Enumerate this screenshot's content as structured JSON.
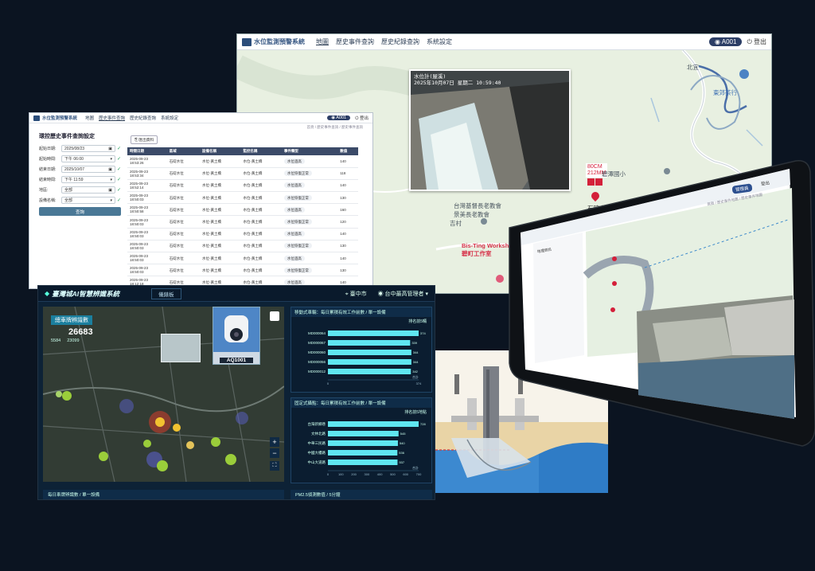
{
  "map_window": {
    "brand": "水位監測預警系統",
    "nav": [
      "地圖",
      "歷史事件查詢",
      "歷史紀錄查詢",
      "系統設定"
    ],
    "user": "A001",
    "logout": "登出",
    "camera": {
      "line1": "水位計(屋溪)",
      "line2": "2025年10月07日 星期二 10:59:40"
    },
    "water_level": "80CM",
    "rainfall": "212MM",
    "station": "石碇水位",
    "places": {
      "church": "台灣基督長老教會\n景美長老教會",
      "place_a": "吉村",
      "workshop": "Bis-Ting Workshop/\n碧町工作室",
      "place_b": "東郊茶行",
      "place_c": "北宜",
      "school": "碧潭國小"
    },
    "accent": "#2c3e66"
  },
  "history_window": {
    "brand": "水位監測預警系統",
    "nav": [
      "地圖",
      "歷史事件查詢",
      "歷史紀錄查詢",
      "系統設定"
    ],
    "user": "A001",
    "logout": "登出",
    "breadcrumb": "首頁 / 歷史事件查詢 / 歷史事件查詢",
    "panel_title": "環控歷史事件查詢設定",
    "filters": [
      {
        "label": "起始日期:",
        "value": "2025/08/23"
      },
      {
        "label": "起始時間:",
        "value": "下午 06:00"
      },
      {
        "label": "結束日期:",
        "value": "2025/10/07"
      },
      {
        "label": "結束時間:",
        "value": "下午 11:59"
      },
      {
        "label": "地區:",
        "value": "全部"
      },
      {
        "label": "設備名稱:",
        "value": "全部"
      }
    ],
    "query_button": "查詢",
    "export_button": "匯出資料",
    "columns": [
      "時間日期",
      "區域",
      "設備名稱",
      "監控名稱",
      "事件類型",
      "數值"
    ],
    "rows": [
      {
        "d": "2025-09-23",
        "t": "18:53:26",
        "area": "石碇水位",
        "dev": "水位-黃土橋",
        "mon": "水位-黃土橋",
        "type": "水位過高",
        "val": "140"
      },
      {
        "d": "2025-09-23",
        "t": "18:53:34",
        "area": "石碇水位",
        "dev": "水位-黃土橋",
        "mon": "水位-黃土橋",
        "type": "水位恢復正常",
        "val": "118"
      },
      {
        "d": "2025-09-23",
        "t": "18:52:14",
        "area": "石碇水位",
        "dev": "水位-黃土橋",
        "mon": "水位-黃土橋",
        "type": "水位過高",
        "val": "140"
      },
      {
        "d": "2025-09-23",
        "t": "18:50:03",
        "area": "石碇水位",
        "dev": "水位-黃土橋",
        "mon": "水位-黃土橋",
        "type": "水位恢復正常",
        "val": "130"
      },
      {
        "d": "2025-09-23",
        "t": "18:50:58",
        "area": "石碇水位",
        "dev": "水位-黃土橋",
        "mon": "水位-黃土橋",
        "type": "水位過高",
        "val": "160"
      },
      {
        "d": "2025-09-23",
        "t": "18:50:03",
        "area": "石碇水位",
        "dev": "水位-黃土橋",
        "mon": "水位-黃土橋",
        "type": "水位恢復正常",
        "val": "120"
      },
      {
        "d": "2025-09-23",
        "t": "18:50:03",
        "area": "石碇水位",
        "dev": "水位-黃土橋",
        "mon": "水位-黃土橋",
        "type": "水位過高",
        "val": "140"
      },
      {
        "d": "2025-09-23",
        "t": "18:50:03",
        "area": "石碇水位",
        "dev": "水位-黃土橋",
        "mon": "水位-黃土橋",
        "type": "水位恢復正常",
        "val": "130"
      },
      {
        "d": "2025-09-23",
        "t": "18:50:03",
        "area": "石碇水位",
        "dev": "水位-黃土橋",
        "mon": "水位-黃土橋",
        "type": "水位過高",
        "val": "140"
      },
      {
        "d": "2025-09-23",
        "t": "18:50:03",
        "area": "石碇水位",
        "dev": "水位-黃土橋",
        "mon": "水位-黃土橋",
        "type": "水位恢復正常",
        "val": "130"
      },
      {
        "d": "2025-09-23",
        "t": "18:12:18",
        "area": "石碇水位",
        "dev": "水位-黃土橋",
        "mon": "水位-黃土橋",
        "type": "水位過高",
        "val": "140"
      },
      {
        "d": "2025-09-23",
        "t": "",
        "area": "",
        "dev": "",
        "mon": "",
        "type": "",
        "val": ""
      }
    ]
  },
  "dashboard": {
    "title": "臺灣城AI智慧辨識系統",
    "tab": "儀錶板",
    "location": "臺中市",
    "admin": "台中最高管理者",
    "count_label": "總車牌辨識數",
    "count_value": "26683",
    "count_sub_a": "5584",
    "count_sub_b": "23099",
    "device_id": "AQ1001",
    "panel1_title": "移動式車輛：每日累積有效工作前數 / 單一設備",
    "panel1_legend": "排名前5輛",
    "panel1_xlabel": "合計",
    "panel2_title": "固定式攝點：每日累積有效工作前數 / 單一設備",
    "panel2_legend": "排名前5地點",
    "panel2_xlabel": "合計",
    "bottom_left_tab": "每日車牌辨識數 / 單一設備",
    "bottom_right_tab": "PM2.5偵測數值 / 5分鐘"
  },
  "chart_data": [
    {
      "type": "bar",
      "orientation": "horizontal",
      "categories": [
        "MD000064",
        "MD000067",
        "MD000060",
        "MD000056",
        "MD000012"
      ],
      "values": [
        374,
        339,
        344,
        344,
        342
      ],
      "xlim": [
        0,
        374
      ],
      "xticks": [
        "0",
        "374"
      ]
    },
    {
      "type": "bar",
      "orientation": "horizontal",
      "categories": [
        "台灣新鄉巷",
        "文林北路",
        "中華三民路",
        "中國大樓路",
        "中山大道路"
      ],
      "values": [
        728,
        545,
        540,
        536,
        537
      ],
      "xlim": [
        0,
        700
      ],
      "xticks": [
        "0",
        "100",
        "200",
        "300",
        "400",
        "500",
        "600",
        "700"
      ]
    }
  ],
  "tablet": {
    "user": "管理員",
    "logout": "登出",
    "breadcrumb": "首頁 / 歷史事件地圖 / 歷史事件地圖",
    "panel_title": "地理資訊"
  }
}
